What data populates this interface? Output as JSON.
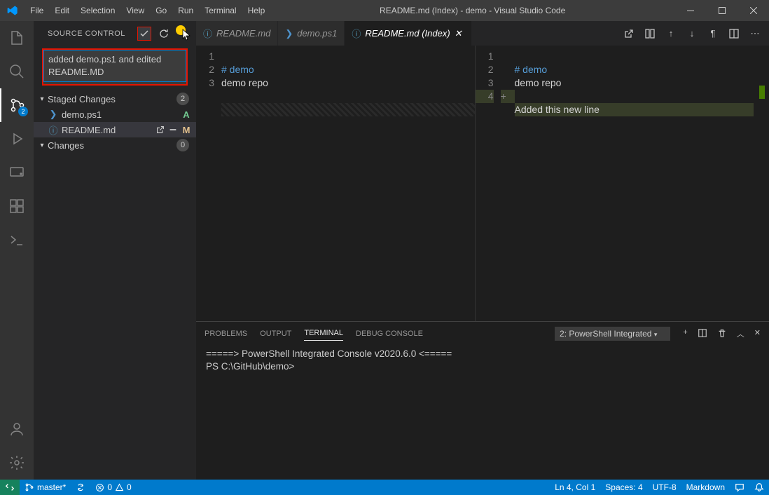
{
  "titlebar": {
    "title": "README.md (Index) - demo - Visual Studio Code",
    "menu": [
      "File",
      "Edit",
      "Selection",
      "View",
      "Go",
      "Run",
      "Terminal",
      "Help"
    ]
  },
  "activity": {
    "scm_badge": "2"
  },
  "sidebar": {
    "title": "SOURCE CONTROL",
    "commit_message": "added demo.ps1 and edited README.MD",
    "staged": {
      "label": "Staged Changes",
      "count": "2"
    },
    "staged_files": [
      {
        "name": "demo.ps1",
        "status": "A",
        "color": "#73c991"
      },
      {
        "name": "README.md",
        "status": "M",
        "color": "#e2c08d"
      }
    ],
    "changes": {
      "label": "Changes",
      "count": "0"
    }
  },
  "tabs": [
    {
      "label": "README.md",
      "icon": "ⓘ",
      "active": false
    },
    {
      "label": "demo.ps1",
      "icon": "",
      "active": false
    },
    {
      "label": "README.md (Index)",
      "icon": "ⓘ",
      "active": true
    }
  ],
  "diff": {
    "left": {
      "lines": [
        {
          "n": "1",
          "text_kw": "# demo"
        },
        {
          "n": "2",
          "text": "demo repo"
        },
        {
          "n": "3",
          "text": ""
        }
      ]
    },
    "right": {
      "lines": [
        {
          "n": "1",
          "text_kw": "# demo"
        },
        {
          "n": "2",
          "text": "demo repo"
        },
        {
          "n": "3",
          "text": ""
        },
        {
          "n": "4",
          "sign": "+",
          "text": "Added this new line",
          "added": true
        }
      ]
    }
  },
  "panel": {
    "tabs": [
      "PROBLEMS",
      "OUTPUT",
      "TERMINAL",
      "DEBUG CONSOLE"
    ],
    "active_tab": "TERMINAL",
    "term_selector": "2: PowerShell Integrated",
    "term_lines": [
      "=====> PowerShell Integrated Console v2020.6.0 <=====",
      "",
      "PS C:\\GitHub\\demo>"
    ]
  },
  "status": {
    "branch": "master*",
    "sync": "",
    "errors": "0",
    "warnings": "0",
    "ln_col": "Ln 4, Col 1",
    "spaces": "Spaces: 4",
    "encoding": "UTF-8",
    "lang": "Markdown"
  }
}
